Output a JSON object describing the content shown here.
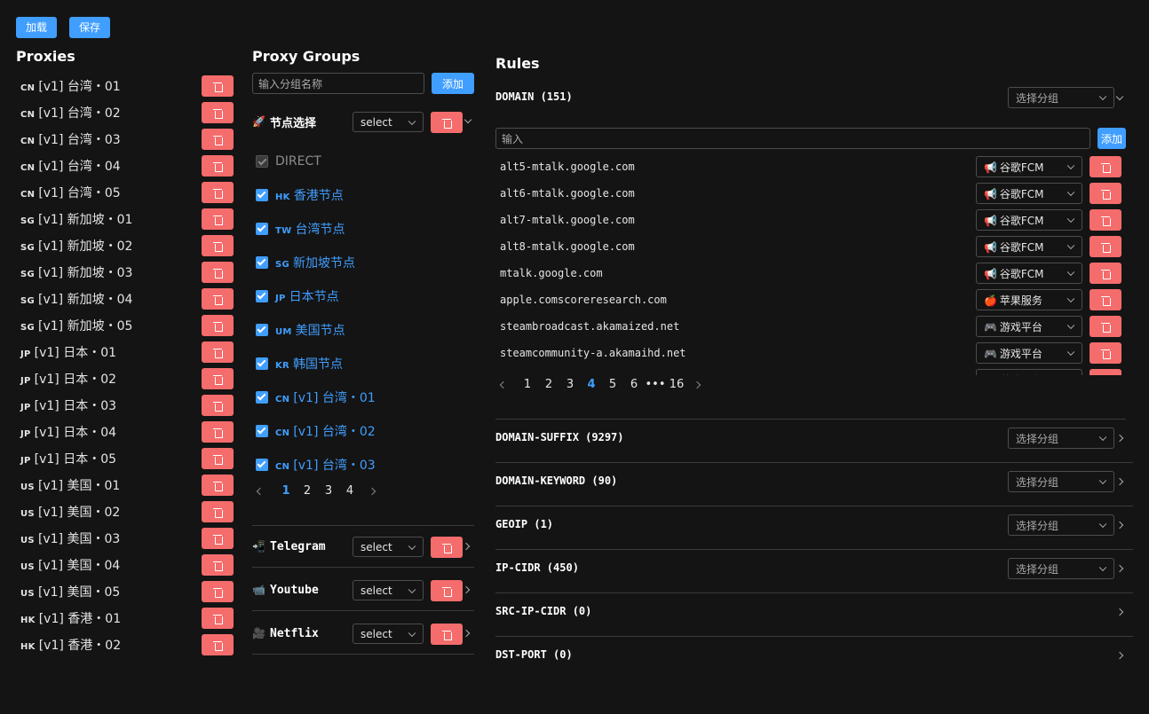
{
  "toolbar": {
    "load_label": "加载",
    "save_label": "保存"
  },
  "proxies": {
    "title": "Proxies",
    "items": [
      {
        "cc": "CN",
        "name": "[v1] 台湾・01"
      },
      {
        "cc": "CN",
        "name": "[v1] 台湾・02"
      },
      {
        "cc": "CN",
        "name": "[v1] 台湾・03"
      },
      {
        "cc": "CN",
        "name": "[v1] 台湾・04"
      },
      {
        "cc": "CN",
        "name": "[v1] 台湾・05"
      },
      {
        "cc": "SG",
        "name": "[v1] 新加坡・01"
      },
      {
        "cc": "SG",
        "name": "[v1] 新加坡・02"
      },
      {
        "cc": "SG",
        "name": "[v1] 新加坡・03"
      },
      {
        "cc": "SG",
        "name": "[v1] 新加坡・04"
      },
      {
        "cc": "SG",
        "name": "[v1] 新加坡・05"
      },
      {
        "cc": "JP",
        "name": "[v1] 日本・01"
      },
      {
        "cc": "JP",
        "name": "[v1] 日本・02"
      },
      {
        "cc": "JP",
        "name": "[v1] 日本・03"
      },
      {
        "cc": "JP",
        "name": "[v1] 日本・04"
      },
      {
        "cc": "JP",
        "name": "[v1] 日本・05"
      },
      {
        "cc": "US",
        "name": "[v1] 美国・01"
      },
      {
        "cc": "US",
        "name": "[v1] 美国・02"
      },
      {
        "cc": "US",
        "name": "[v1] 美国・03"
      },
      {
        "cc": "US",
        "name": "[v1] 美国・04"
      },
      {
        "cc": "US",
        "name": "[v1] 美国・05"
      },
      {
        "cc": "HK",
        "name": "[v1] 香港・01"
      },
      {
        "cc": "HK",
        "name": "[v1] 香港・02"
      }
    ]
  },
  "groups": {
    "title": "Proxy Groups",
    "input_placeholder": "输入分组名称",
    "add_label": "添加",
    "expanded": {
      "icon": "rocket-icon",
      "emoji": "🚀",
      "name": "节点选择",
      "type": "select",
      "members": [
        {
          "cc": "",
          "name": "DIRECT",
          "checked": true,
          "disabled": true
        },
        {
          "cc": "HK",
          "name": "香港节点",
          "checked": true
        },
        {
          "cc": "TW",
          "name": "台湾节点",
          "checked": true
        },
        {
          "cc": "SG",
          "name": "新加坡节点",
          "checked": true
        },
        {
          "cc": "JP",
          "name": "日本节点",
          "checked": true
        },
        {
          "cc": "UM",
          "name": "美国节点",
          "checked": true
        },
        {
          "cc": "KR",
          "name": "韩国节点",
          "checked": true
        },
        {
          "cc": "CN",
          "name": "[v1] 台湾・01",
          "checked": true
        },
        {
          "cc": "CN",
          "name": "[v1] 台湾・02",
          "checked": true
        },
        {
          "cc": "CN",
          "name": "[v1] 台湾・03",
          "checked": true
        }
      ],
      "pagination": {
        "pages": [
          "1",
          "2",
          "3",
          "4"
        ],
        "current": "1"
      }
    },
    "collapsed": [
      {
        "icon": "telegram-icon",
        "emoji": "📲",
        "name": "Telegram",
        "type": "select"
      },
      {
        "icon": "youtube-icon",
        "emoji": "📹",
        "name": "Youtube",
        "type": "select"
      },
      {
        "icon": "netflix-icon",
        "emoji": "🎥",
        "name": "Netflix",
        "type": "select"
      }
    ]
  },
  "rules": {
    "title": "Rules",
    "select_placeholder": "选择分组",
    "input_placeholder": "输入",
    "add_label": "添加",
    "domain": {
      "title": "DOMAIN (151)",
      "items": [
        {
          "value": "alt5-mtalk.google.com",
          "emoji": "📢",
          "group": "谷歌FCM"
        },
        {
          "value": "alt6-mtalk.google.com",
          "emoji": "📢",
          "group": "谷歌FCM"
        },
        {
          "value": "alt7-mtalk.google.com",
          "emoji": "📢",
          "group": "谷歌FCM"
        },
        {
          "value": "alt8-mtalk.google.com",
          "emoji": "📢",
          "group": "谷歌FCM"
        },
        {
          "value": "mtalk.google.com",
          "emoji": "📢",
          "group": "谷歌FCM"
        },
        {
          "value": "apple.comscoreresearch.com",
          "emoji": "🍎",
          "group": "苹果服务"
        },
        {
          "value": "steambroadcast.akamaized.net",
          "emoji": "🎮",
          "group": "游戏平台"
        },
        {
          "value": "steamcommunity-a.akamaihd.net",
          "emoji": "🎮",
          "group": "游戏平台"
        }
      ],
      "pagination": {
        "pages": [
          "1",
          "2",
          "3",
          "4",
          "5",
          "6",
          "•••",
          "16"
        ],
        "current": "4"
      }
    },
    "sections": [
      {
        "title": "DOMAIN-SUFFIX (9297)",
        "has_select": true
      },
      {
        "title": "DOMAIN-KEYWORD (90)",
        "has_select": true
      },
      {
        "title": "GEOIP (1)",
        "has_select": true
      },
      {
        "title": "IP-CIDR (450)",
        "has_select": true
      },
      {
        "title": "SRC-IP-CIDR (0)",
        "has_select": false
      },
      {
        "title": "DST-PORT (0)",
        "has_select": false
      }
    ]
  },
  "colors": {
    "accent": "#409eff",
    "danger": "#f56c6c",
    "background": "#141414"
  }
}
